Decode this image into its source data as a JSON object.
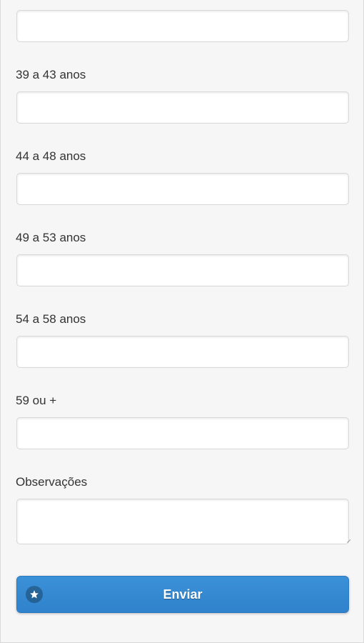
{
  "form": {
    "fields": [
      {
        "label": "39 a 43 anos",
        "value": ""
      },
      {
        "label": "44 a 48 anos",
        "value": ""
      },
      {
        "label": "49 a 53 anos",
        "value": ""
      },
      {
        "label": "54 a 58 anos",
        "value": ""
      },
      {
        "label": "59 ou +",
        "value": ""
      }
    ],
    "previous_field_value": "",
    "notes": {
      "label": "Observações",
      "value": ""
    },
    "submit": {
      "label": "Enviar",
      "icon": "star-icon"
    }
  },
  "colors": {
    "background": "#f6f6f6",
    "button": "#3088d0",
    "text": "#333333"
  }
}
